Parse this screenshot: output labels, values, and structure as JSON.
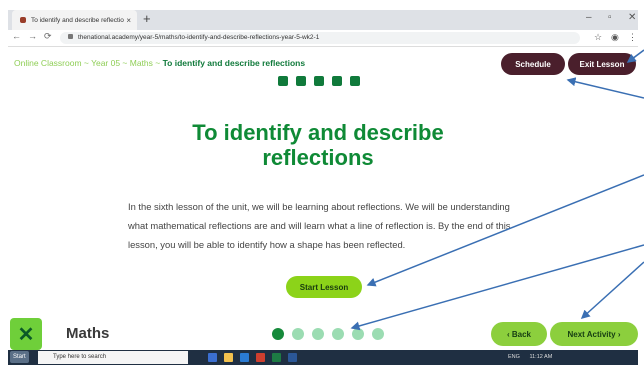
{
  "browser": {
    "tab_title": "To identify and describe reflectio",
    "url": "thenational.academy/year-5/maths/to-identify-and-describe-reflections-year-5-wk2-1"
  },
  "breadcrumb": {
    "part1": "Online Classroom ~ Year 05 ~ Maths ~ ",
    "current": "To identify and describe reflections"
  },
  "header_buttons": {
    "schedule": "Schedule",
    "exit": "Exit Lesson"
  },
  "lesson": {
    "title": "To identify and describe reflections",
    "description": "In the sixth lesson of the unit, we will be learning about reflections. We will be understanding what mathematical reflections are and will learn what a line of reflection is. By the end of this lesson, you will be able to identify how a shape has been reflected.",
    "start_button": "Start Lesson"
  },
  "footer": {
    "subject": "Maths",
    "back_button": "Back",
    "next_button": "Next Activity",
    "progress_dots": 6,
    "active_dot": 0
  },
  "taskbar": {
    "start_label": "Start",
    "search_placeholder": "Type here to search",
    "time": "11:12 AM",
    "lang": "ENG"
  },
  "colors": {
    "brand_green": "#0f8a36",
    "dark_button": "#4a1f2c",
    "lime_button": "#8cd319"
  },
  "icons": [
    "facebook-icon",
    "whatsapp-icon",
    "twitter-icon",
    "pinterest-icon",
    "email-icon"
  ]
}
